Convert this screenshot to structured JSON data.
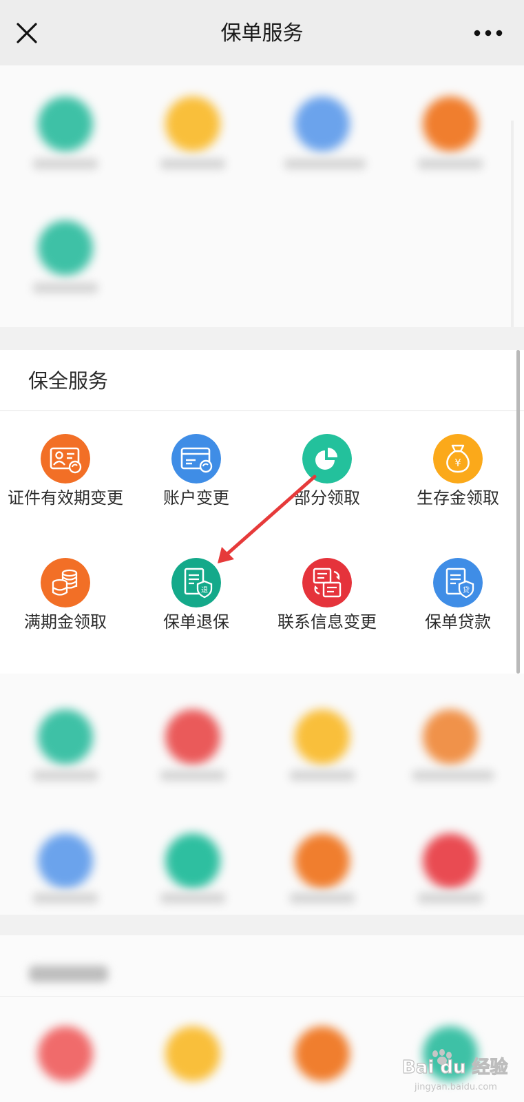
{
  "header": {
    "title": "保单服务",
    "close_icon": "close-icon",
    "more_icon": "more-dots-icon"
  },
  "blurred_top": {
    "icon_colors": [
      "#3ec1a6",
      "#f9bf3b",
      "#6ba3ec",
      "#f07e2e",
      "#3ec1a6"
    ]
  },
  "section": {
    "title": "保全服务",
    "items": [
      {
        "label": "证件有效期变更",
        "icon": "id-card-refresh-icon",
        "color": "#f26f26"
      },
      {
        "label": "账户变更",
        "icon": "bank-card-refresh-icon",
        "color": "#3f8de6"
      },
      {
        "label": "部分领取",
        "icon": "pie-chart-icon",
        "color": "#23c19c"
      },
      {
        "label": "生存金领取",
        "icon": "money-bag-icon",
        "color": "#fba91a"
      },
      {
        "label": "满期金领取",
        "icon": "coin-stack-icon",
        "color": "#f26f26"
      },
      {
        "label": "保单退保",
        "icon": "document-shield-refund-icon",
        "color": "#14a98a"
      },
      {
        "label": "联系信息变更",
        "icon": "documents-swap-icon",
        "color": "#e5333b"
      },
      {
        "label": "保单贷款",
        "icon": "document-shield-loan-icon",
        "color": "#3f8de6"
      }
    ],
    "badges": {
      "refund": "退",
      "loan": "贷",
      "yen": "¥"
    }
  },
  "blurred_bottom": {
    "icon_colors": [
      "#3ec1a6",
      "#ea5a5a",
      "#f9bf3b",
      "#f0924a",
      "#6ba3ec",
      "#2ebfa0",
      "#f07e2e",
      "#e94b52"
    ],
    "last_row_colors": [
      "#f06b6b",
      "#f9bf3b",
      "#f07e2e",
      "#3ec1a6"
    ]
  },
  "annotation": {
    "arrow_color": "#e63a3a"
  },
  "watermark": {
    "logo_text": "Bai du 经验",
    "url": "jingyan.baidu.com"
  }
}
